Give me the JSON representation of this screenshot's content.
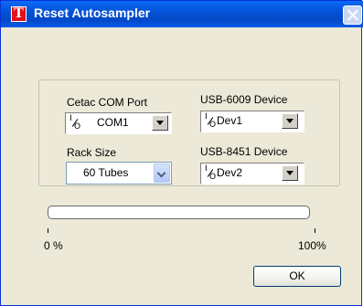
{
  "window": {
    "title": "Reset Autosampler",
    "icon": "T"
  },
  "cetac_com_port": {
    "label": "Cetac COM Port",
    "value": "COM1"
  },
  "usb6009": {
    "label": "USB-6009 Device",
    "value": "Dev1"
  },
  "rack_size": {
    "label": "Rack Size",
    "value": "60 Tubes"
  },
  "usb8451": {
    "label": "USB-8451 Device",
    "value": "Dev2"
  },
  "progress": {
    "value": 0,
    "min_label": "0 %",
    "max_label": "100%"
  },
  "buttons": {
    "ok": "OK"
  }
}
